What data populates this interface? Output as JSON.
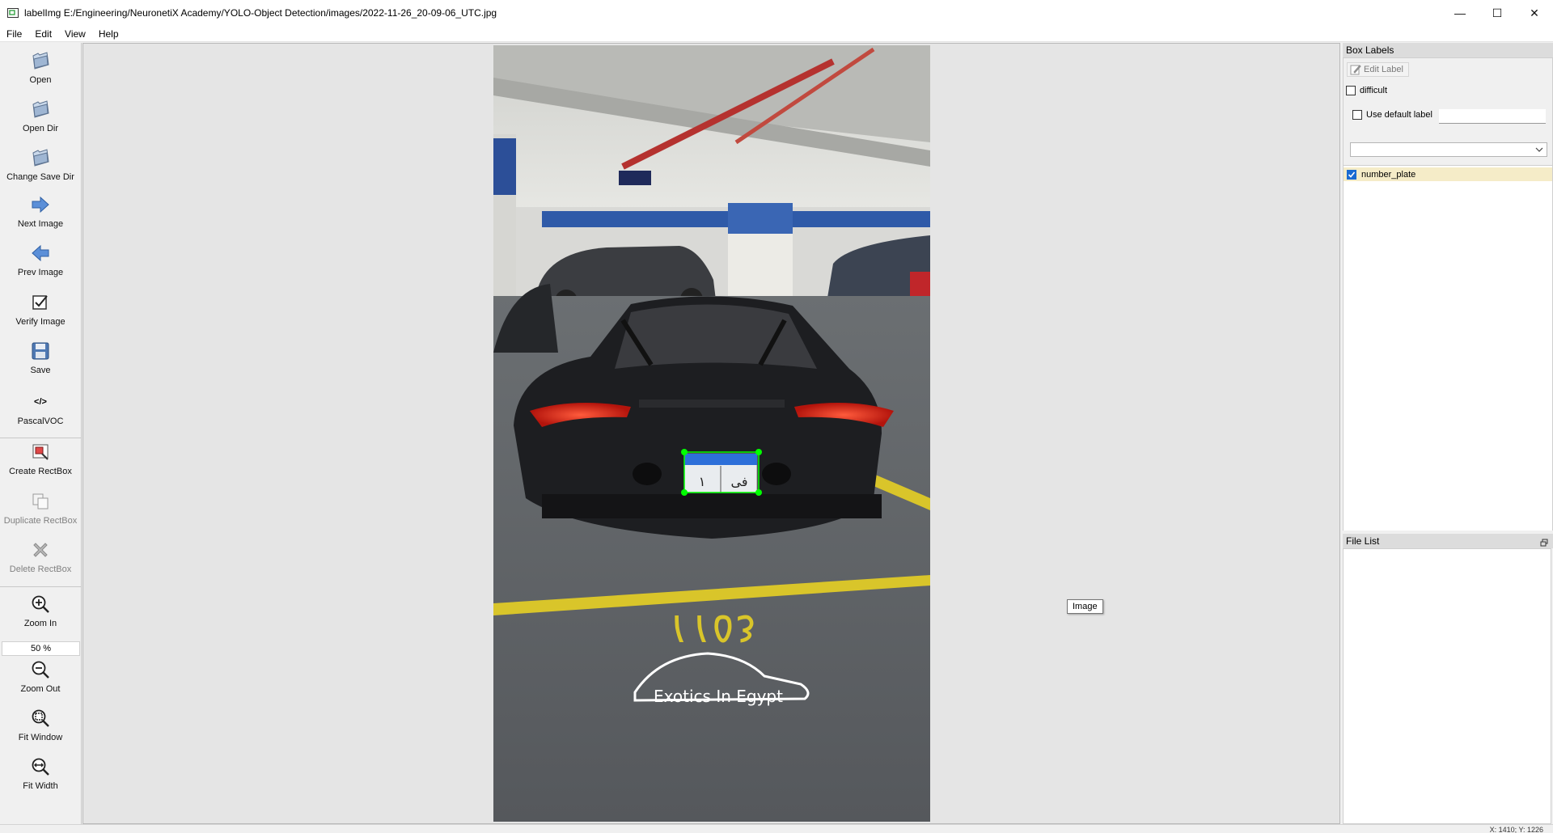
{
  "window": {
    "title": "labelImg E:/Engineering/NeuronetiX Academy/YOLO-Object Detection/images/2022-11-26_20-09-06_UTC.jpg",
    "minimize": "—",
    "maximize": "☐",
    "close": "✕"
  },
  "menu": [
    "File",
    "Edit",
    "View",
    "Help"
  ],
  "toolbar": {
    "open": "Open",
    "open_dir": "Open Dir",
    "change_save_dir": "Change Save Dir",
    "next_image": "Next Image",
    "prev_image": "Prev Image",
    "verify_image": "Verify Image",
    "save": "Save",
    "format_icon": "</>",
    "format": "PascalVOC",
    "create_rectbox": "Create RectBox",
    "duplicate_rectbox": "Duplicate RectBox",
    "delete_rectbox": "Delete RectBox",
    "zoom_in": "Zoom In",
    "zoom_value": "50 %",
    "zoom_out": "Zoom Out",
    "fit_window": "Fit Window",
    "fit_width": "Fit Width"
  },
  "canvas": {
    "tooltip": "Image",
    "watermark": "Exotics In Egypt",
    "floor_number": "٤٥١١",
    "plate_text_left": "١",
    "plate_text_right": "فى"
  },
  "box_labels": {
    "title": "Box Labels",
    "edit_label": "Edit Label",
    "difficult": "difficult",
    "difficult_checked": false,
    "use_default_label": "Use default label",
    "use_default_checked": false,
    "default_label_value": "",
    "combo_value": "",
    "labels": [
      {
        "name": "number_plate",
        "checked": true
      }
    ]
  },
  "file_list": {
    "title": "File List",
    "files": []
  },
  "status": {
    "coords": "X: 1410; Y: 1226"
  },
  "colors": {
    "accent": "#1a6bd1",
    "bbox": "#00ff00",
    "selected_label_bg": "#f5ecc8"
  }
}
